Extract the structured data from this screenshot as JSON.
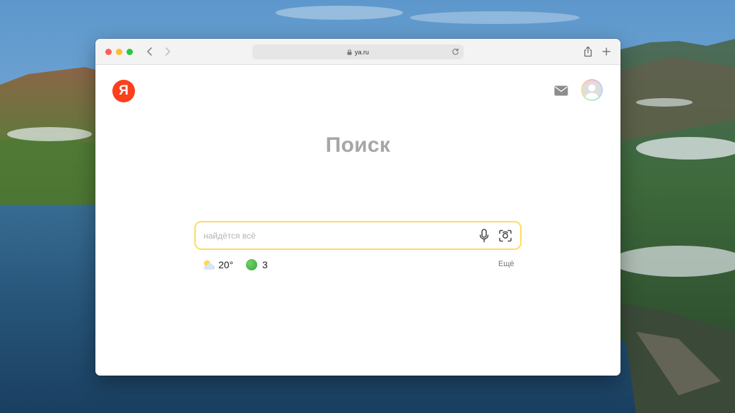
{
  "browser": {
    "url": "ya.ru"
  },
  "page": {
    "logo_letter": "Я",
    "title": "Поиск",
    "search": {
      "placeholder": "найдётся всё",
      "value": ""
    },
    "weather": {
      "icon": "partly-cloudy-icon",
      "temperature": "20°"
    },
    "traffic": {
      "icon": "traffic-green-icon",
      "score": "3"
    },
    "more_label": "Ещё"
  },
  "colors": {
    "yandex_red": "#fc3f1d",
    "search_border": "#ffdc60",
    "traffic_green": "#3aa53a"
  }
}
